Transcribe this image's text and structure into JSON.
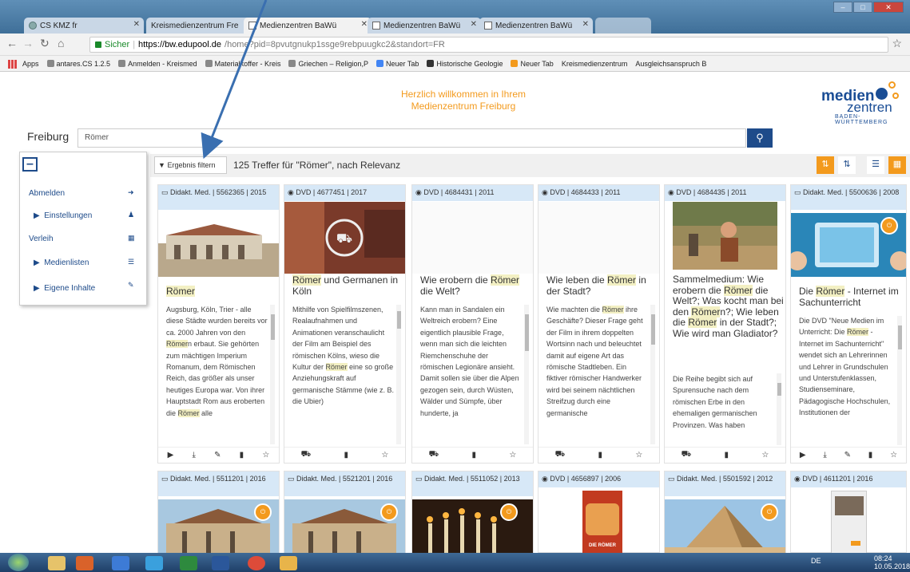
{
  "browser": {
    "tabs": [
      {
        "label": "CS KMZ fr",
        "active": false
      },
      {
        "label": "Kreismedienzentrum Fre",
        "active": false
      },
      {
        "label": "Medienzentren BaWü",
        "active": true
      },
      {
        "label": "Medienzentren BaWü",
        "active": false
      },
      {
        "label": "Medienzentren BaWü",
        "active": false
      }
    ],
    "secure_label": "Sicher",
    "url_domain": "https://bw.edupool.de",
    "url_path": "/home?pid=8pvutgnukp1ssge9rebpuugkc2&standort=FR",
    "bookmarks": [
      "Apps",
      "antares.CS 1.2.5",
      "Anmelden - Kreismed",
      "Materialkoffer - Kreis",
      "Griechen – Religion,P",
      "Neuer Tab",
      "Historische Geologie",
      "Neuer Tab",
      "Kreismedienzentrum",
      "Ausgleichsanspruch B"
    ]
  },
  "header": {
    "welcome_line1": "Herzlich willkommen in Ihrem",
    "welcome_line2": "Medienzentrum Freiburg",
    "logo_medien": "medien",
    "logo_zentren": "zentren",
    "logo_region": "BADEN-WÜRTTEMBERG"
  },
  "search": {
    "location": "Freiburg",
    "query": "Römer",
    "button_icon": "search-icon"
  },
  "sidebar": {
    "items": [
      {
        "label": "Abmelden",
        "icon": "sign-out-icon",
        "sub": false
      },
      {
        "label": "Einstellungen",
        "icon": "user-icon",
        "sub": true
      },
      {
        "label": "Verleih",
        "icon": "calendar-icon",
        "sub": false
      },
      {
        "label": "Medienlisten",
        "icon": "list-icon",
        "sub": true
      },
      {
        "label": "Eigene Inhalte",
        "icon": "edit-icon",
        "sub": true
      }
    ]
  },
  "toolbar": {
    "filter_label": "Ergebnis filtern",
    "hits_text": "125 Treffer für \"Römer\", nach Relevanz",
    "view_buttons": [
      "sort-desc-icon",
      "sort-asc-icon",
      "list-view-icon",
      "grid-view-icon"
    ]
  },
  "results_row1": [
    {
      "meta": "Didakt. Med. | 5562365 | 2015",
      "title": "Römer",
      "desc": "Augsburg, Köln, Trier - alle diese Städte wurden bereits vor ca. 2000 Jahren von den Römern erbaut. Sie gehörten zum mächtigen Imperium Romanum, dem Römischen Reich, das größer als unser heutiges Europa war. Von ihrer Hauptstadt Rom aus eroberten die Römer alle"
    },
    {
      "meta": "DVD | 4677451 | 2017",
      "title": "Römer und Germanen in Köln",
      "desc": "Mithilfe von Spielfilmszenen, Realaufnahmen und Animationen veranschaulicht der Film am Beispiel des römischen Kölns, wieso die Kultur der Römer eine so große Anziehungskraft auf germanische Stämme (wie z. B. die Ubier)"
    },
    {
      "meta": "DVD | 4684431 | 2011",
      "title": "Wie erobern die Römer die Welt?",
      "desc": "Kann man in Sandalen ein Weltreich erobern? Eine eigentlich plausible Frage, wenn man sich die leichten Riemchenschuhe der römischen Legionäre ansieht. Damit sollen sie über die Alpen gezogen sein, durch Wüsten, Wälder und Sümpfe, über hunderte, ja"
    },
    {
      "meta": "DVD | 4684433 | 2011",
      "title": "Wie leben die Römer in der Stadt?",
      "desc": "Wie machten die Römer ihre Geschäfte? Dieser Frage geht der Film in ihrem doppelten Wortsinn nach und beleuchtet damit auf eigene Art das römische Stadtleben. Ein fiktiver römischer Handwerker wird bei seinem nächtlichen Streifzug durch eine germanische"
    },
    {
      "meta": "DVD | 4684435 | 2011",
      "title": "Sammelmedium: Wie erobern die Römer die Welt?; Was kocht man bei den Römern?; Wie leben die Römer in der Stadt?; Wie wird man Gladiator?",
      "desc": "Die Reihe begibt sich auf Spurensuche nach dem römischen Erbe in den ehemaligen germanischen Provinzen. Was haben"
    },
    {
      "meta": "Didakt. Med. | 5500636 | 2008",
      "title": "Die Römer - Internet im Sachunterricht",
      "desc": "Die DVD \"Neue Medien im Unterricht: Die Römer - Internet im Sachunterricht\" wendet sich an Lehrerinnen und Lehrer in Grundschulen und Unterstufenklassen, Studienseminare, Pädagogische Hochschulen, Institutionen der"
    }
  ],
  "results_row2": [
    {
      "meta": "Didakt. Med. | 5511201 | 2016"
    },
    {
      "meta": "Didakt. Med. | 5521201 | 2016"
    },
    {
      "meta": "Didakt. Med. | 5511052 | 2013"
    },
    {
      "meta": "DVD | 4656897 | 2006"
    },
    {
      "meta": "Didakt. Med. | 5501592 | 2012"
    },
    {
      "meta": "DVD | 4611201 | 2016"
    }
  ],
  "thumb_texts": {
    "dvd_cover": "DIE RÖMER"
  },
  "taskbar": {
    "lang": "DE",
    "time": "08:24",
    "date": "10.05.2018"
  },
  "colors": {
    "accent_blue": "#1e4b8a",
    "accent_orange": "#f39a1d",
    "card_header": "#d7e8f7",
    "highlight": "#f3f0c3"
  }
}
